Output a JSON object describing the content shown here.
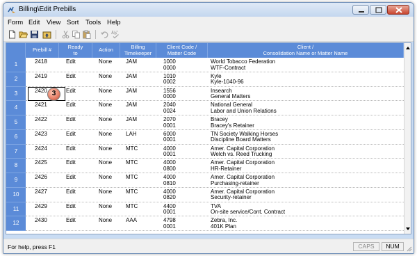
{
  "window": {
    "title": "Billing\\Edit Prebills"
  },
  "menu": [
    "Form",
    "Edit",
    "View",
    "Sort",
    "Tools",
    "Help"
  ],
  "toolbar_icons": [
    "new-document-icon",
    "open-folder-icon",
    "save-icon",
    "folder-up-icon",
    "cut-icon",
    "copy-icon",
    "paste-icon",
    "undo-icon",
    "spell-check-icon"
  ],
  "columns": [
    "Prebill #",
    "Ready\nto",
    "Action",
    "Billing\nTimekeeper",
    "Client Code /\nMatter Code",
    "Client /\nConsolidation Name or Matter Name"
  ],
  "rows": [
    {
      "num": "1",
      "prebill": "2418",
      "ready": "Edit",
      "action": "None",
      "tk": "JAM",
      "client_code": "1000",
      "matter_code": "0000",
      "client": "World  Tobacco Federation",
      "matter": "WTF-Contract"
    },
    {
      "num": "2",
      "prebill": "2419",
      "ready": "Edit",
      "action": "None",
      "tk": "JAM",
      "client_code": "1010",
      "matter_code": "0002",
      "client": "Kyle",
      "matter": "Kyle-1040-96"
    },
    {
      "num": "3",
      "prebill": "2420",
      "ready": "Edit",
      "action": "None",
      "tk": "JAM",
      "client_code": "1556",
      "matter_code": "0000",
      "client": "Insearch",
      "matter": "General Matters"
    },
    {
      "num": "4",
      "prebill": "2421",
      "ready": "Edit",
      "action": "None",
      "tk": "JAM",
      "client_code": "2040",
      "matter_code": "0024",
      "client": "National General",
      "matter": "Labor and Union Relations"
    },
    {
      "num": "5",
      "prebill": "2422",
      "ready": "Edit",
      "action": "None",
      "tk": "JAM",
      "client_code": "2070",
      "matter_code": "0001",
      "client": "Bracey",
      "matter": "Bracey's Retainer"
    },
    {
      "num": "6",
      "prebill": "2423",
      "ready": "Edit",
      "action": "None",
      "tk": "LAH",
      "client_code": "6000",
      "matter_code": "0001",
      "client": "TN Society Walking Horses",
      "matter": "Discipline Board Matters"
    },
    {
      "num": "7",
      "prebill": "2424",
      "ready": "Edit",
      "action": "None",
      "tk": "MTC",
      "client_code": "4000",
      "matter_code": "0001",
      "client": "Amer. Capital Corporation",
      "matter": "Welch vs. Reed Trucking"
    },
    {
      "num": "8",
      "prebill": "2425",
      "ready": "Edit",
      "action": "None",
      "tk": "MTC",
      "client_code": "4000",
      "matter_code": "0800",
      "client": "Amer. Capital Corporation",
      "matter": "HR-Retainer"
    },
    {
      "num": "9",
      "prebill": "2426",
      "ready": "Edit",
      "action": "None",
      "tk": "MTC",
      "client_code": "4000",
      "matter_code": "0810",
      "client": "Amer. Capital Corporation",
      "matter": "Purchasing-retainer"
    },
    {
      "num": "10",
      "prebill": "2427",
      "ready": "Edit",
      "action": "None",
      "tk": "MTC",
      "client_code": "4000",
      "matter_code": "0820",
      "client": "Amer. Capital Corporation",
      "matter": "Security-retainer"
    },
    {
      "num": "11",
      "prebill": "2429",
      "ready": "Edit",
      "action": "None",
      "tk": "MTC",
      "client_code": "4400",
      "matter_code": "0001",
      "client": "TVA",
      "matter": "On-site service/Cont. Contract"
    },
    {
      "num": "12",
      "prebill": "2430",
      "ready": "Edit",
      "action": "None",
      "tk": "AAA",
      "client_code": "4798",
      "matter_code": "0001",
      "client": "Zebra, Inc.",
      "matter": "401K Plan"
    }
  ],
  "callout": "3",
  "status": {
    "help": "For help, press F1",
    "caps": "CAPS",
    "num": "NUM"
  },
  "colors": {
    "header_bg": "#5b8bd8",
    "window_frame": "#c9dcf3",
    "close_button": "#c8452f",
    "callout": "#e8826a"
  }
}
